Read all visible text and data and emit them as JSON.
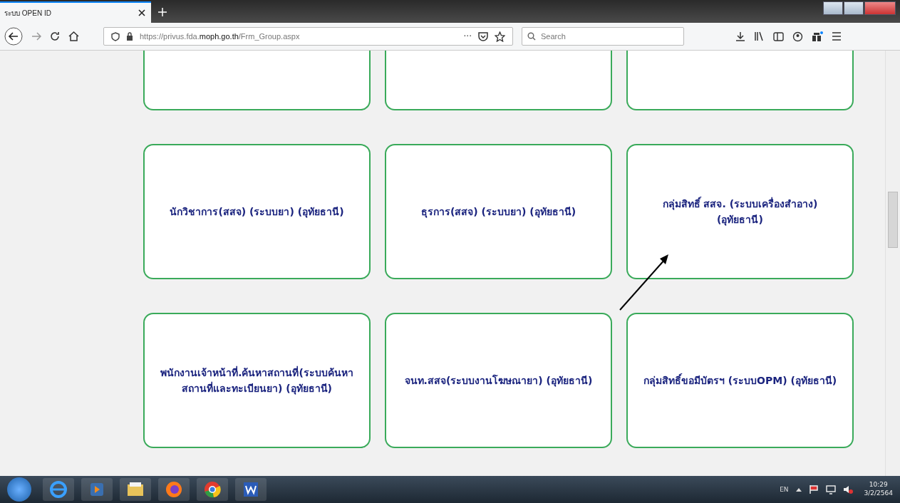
{
  "browser": {
    "tab_title": "ระบบ OPEN ID",
    "url_prefix": "https://privus.fda.",
    "url_domain": "moph.go.th",
    "url_path": "/Frm_Group.aspx",
    "page_actions": "···",
    "search": {
      "placeholder": "Search"
    }
  },
  "cards": [
    {
      "kind": "cut"
    },
    {
      "kind": "cut"
    },
    {
      "kind": "cut"
    },
    {
      "kind": "full",
      "label": "นักวิชาการ(สสจ) (ระบบยา) (อุทัยธานี)"
    },
    {
      "kind": "full",
      "label": "ธุรการ(สสจ) (ระบบยา) (อุทัยธานี)"
    },
    {
      "kind": "full",
      "label": "กลุ่มสิทธิ์ สสจ. (ระบบเครื่องสำอาง) (อุทัยธานี)"
    },
    {
      "kind": "full",
      "label": "พนักงานเจ้าหน้าที่.ค้นหาสถานที่(ระบบค้นหาสถานที่และทะเบียนยา) (อุทัยธานี)"
    },
    {
      "kind": "full",
      "label": "จนท.สสจ(ระบบงานโฆษณายา) (อุทัยธานี)"
    },
    {
      "kind": "full",
      "label": "กลุ่มสิทธิ์ขอมีบัตรฯ (ระบบOPM) (อุทัยธานี)"
    }
  ],
  "taskbar": {
    "language": "EN",
    "time": "10:29",
    "date": "3/2/2564"
  }
}
